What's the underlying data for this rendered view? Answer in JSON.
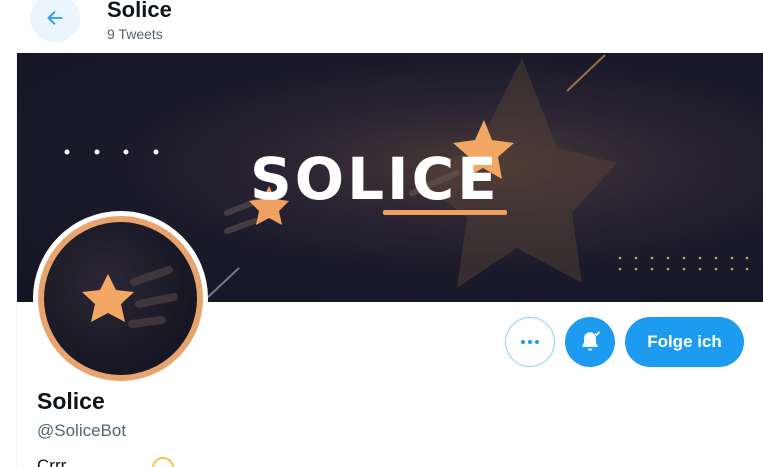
{
  "header": {
    "title": "Solice",
    "subtitle": "9 Tweets"
  },
  "banner": {
    "wordmark": "SOLICE"
  },
  "profile": {
    "display_name": "Solice",
    "handle": "@SoliceBot",
    "bio_partial": "Crrr"
  },
  "actions": {
    "follow_label": "Folge ich"
  },
  "colors": {
    "accent": "#1d9bf0",
    "star": "#f0a060",
    "avatar_ring": "#e8a46f"
  },
  "icons": {
    "back": "arrow-left-icon",
    "more": "more-horizontal-icon",
    "bell": "bell-check-icon"
  }
}
